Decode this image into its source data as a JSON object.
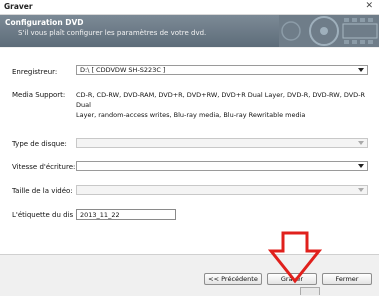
{
  "window": {
    "title": "Graver",
    "close_glyph": "✕"
  },
  "header": {
    "title": "Configuration DVD",
    "subtitle": "S'il vous plaît configurer les paramètres de votre dvd."
  },
  "form": {
    "recorder_label": "Enregistreur:",
    "recorder_value": "D:\\ [ CDDVDW SH-S223C ]",
    "media_label": "Media Support:",
    "media_lines": [
      "CD-R, CD-RW, DVD-RAM, DVD+R, DVD+RW, DVD+R Dual Layer, DVD-R, DVD-RW, DVD-R Dual",
      "Layer, random-access writes, Blu-ray media, Blu-ray Rewritable media"
    ],
    "disc_type_label": "Type de disque:",
    "disc_type_value": "",
    "speed_label": "Vitesse d'écriture:",
    "speed_value": "",
    "video_size_label": "Taille de la vidéo:",
    "video_size_value": "",
    "disc_label_label": "L'étiquette du dis",
    "disc_label_value": "2013_11_22"
  },
  "footer": {
    "prev_label": "<< Précédente",
    "burn_label": "Graver",
    "close_label": "Fermer"
  },
  "colors": {
    "header_bg": "#6b7985",
    "arrow": "#e0201c"
  }
}
